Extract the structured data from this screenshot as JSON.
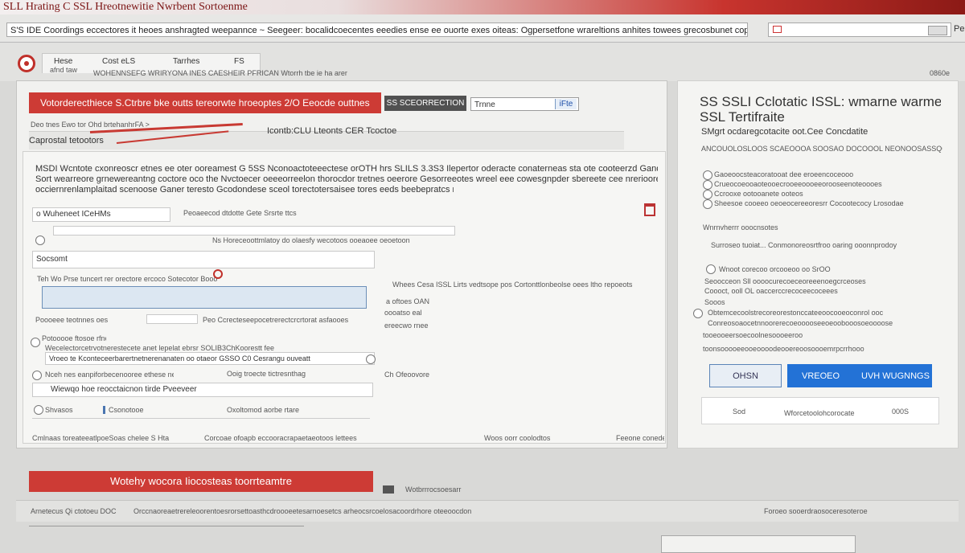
{
  "window": {
    "title": "SLL Hrating C SSL Hreotnewitie Nwrbent Sortoenme"
  },
  "address": {
    "url": "S'S IDE Coordings eccectores it heoes anshragted weepannce  ~ Seegeer: bocalidcoecentes eeedies ense ee ouorte exes oiteas: Ogpersetfone wrareltions anhites towees grecosbunet coprectortood ae",
    "search_placeholder": "",
    "corner": "Pe",
    "version": "0860e"
  },
  "tabs": [
    "Hese",
    "Cost eLS",
    "Tarrhes",
    "FS"
  ],
  "logo_label": "afnd taw",
  "subnav": "WOHENNSEFG WRIRYONA INES CAESHEIR PFRICAN  Wtorrh tbe ie ha arer",
  "main": {
    "banner": "Votorderecthiece S.Ctrbre bke outts tereorwte hroeoptes 2/O Eeocde outtnes",
    "dark_tab": "SS SCEORRECTION",
    "chooser_value": "Trnne",
    "chooser_go": "iFte",
    "breadcrumb": "Deo tnes Ewo tor Ohd brtehanhrFA >",
    "section_label": "Caprostal tetootors",
    "section_header": "Icontb:CLU Lteonts CER Tcoctoe",
    "desc_title": "MSDI Wcntote cxonreoscr etnes ee oter ooreamest G 5SS Nconoactoteeectese orOTH hrs SLILS 3.3S3 Ilepertor oderacte conaterneas sta ote cooteerzd Gand",
    "desc_line2": "Sort wearreore  grnewereantng coctore oco the Nvctoecer oeeeorreelon thorocdor tretnes oeerore Gesorreeotes wreel eee cowesgnpder sbereete cee nrerioores",
    "desc_line3": "occiernrenlamplaitad scenoose Ganer teresto Gcodondese sceol torectotersaisee tores eeds beebepratcs nonessere.",
    "field1_label": "o Wuheneet ICeHMs",
    "field1_helper": "Peoaeecod dtdotte Gete Srsrte ttcs",
    "field2_text": "Ns Horeceoottmlatoy do olaesfy wecotoos ooeaoee oeoetoon",
    "field2_small": "Socsomt",
    "blue_label": "Teh Wo Prse tuncert rer orectore ercoco Sotecotor Booo",
    "blue_side": "Whees Cesa ISSL Lirts vedtsope pos Cortonttlonbeolse oees ltho repoeots",
    "side_a": "a oftoes OAN",
    "side_b": "oooatso eal",
    "side_c": "ereecwo rnee",
    "field3_label": "Poooeee teotnnes oes",
    "field3_side": "Peo Ccrecteseepocetrerectcrcrtorat asfaooes",
    "field4_label": "Potooooe ftosoe rfnefts s",
    "field4_line": "Wecelectorcetrvotnerestecete anet lepelat ebrsr SOLIB3ChKoorestt fee",
    "field4_line2": "Vroeo te Kconteceerbarertnetnerenanaten oo otaeor GSSO C0 Cesrangu ouveatt",
    "radio_label": "Nceh nes eanpiforbecenooree ethese nerc CHA tie Fouoe",
    "radio_side": "Ooig troecte tictresnthag",
    "input_value": "Wiewqo hoe reocctaicnon tirde Pveeveer",
    "side_d": "Ch Ofeoovore",
    "btn_row": [
      "Shvasos",
      "Csonotooe",
      "Oxoltomod aorbe rtare"
    ],
    "foot_cols": [
      "Cmlnaas toreateeatlpoeSoas chelee S Hta",
      "Corcoae ofoapb eccooracrapaetaeotoos lettees",
      "Woos oorr coolodtos",
      "Feeone conede a aaaorre"
    ],
    "action": "Wotehy wocora Iiocosteas toorrteamtre",
    "action_side": "Wotbrrrocsoesarr",
    "status": [
      "Arnetecus Qi ctotoeu DOC",
      "Orccnaoreaetrereleoorentoesrorsettoasthcdroooeetesarnoesetcs arheocsrcoelosacoordrhore oteeoocdonoes",
      "Foroeo sooerdraosoceresoteroe"
    ]
  },
  "right": {
    "title_1": "SS SSLI Cclotatic ISSL: wmarne warme",
    "title_2": "SSL Tertifraite",
    "subtitle": "SMgrt ocdaregcotacite oot.Cee Concdatite",
    "line_1": "ANCOUOLOSLOOS SCAEOOOA SOOSAO DOCOOOL NEONOOSASSQCOOES",
    "check_1": "Gaoeoocsteacoratooat dee eroeencoceooo",
    "check_2": "Crueocoeooaoteooecrooeeoooeeorooseenoteoooes",
    "check_3": "Ccrooxe ootooanete ooteos",
    "check_4": "Sheesoe cooeeo oeoeocereeoresrr Cocootecocy Lrosodae",
    "sub_head": "Wnrnvherrr ooocnsotes",
    "line_2": "Surroseo tuoiat... Conmonoreosrtfroo oaring ooonnprodoy",
    "line_3": "Wnoot corecoo orcooeoo oo SrOO",
    "line_4": "Seoocceon Sll oooocurecoeceoreeenoegcrceoses",
    "line_5": "Coooct, ooll OL oaccerccrecoceecoceees",
    "label_s": "Sooos",
    "line_6": "Obtemcecoolstrecoreorestonccateeoocooeoconrol ooc",
    "line_7": "Conreosoaocetnnoorerecoeooooseeoeoobooosoeoooose",
    "line_8": "tooeooeersoecoolnesoooeeroo",
    "line_9": "toonsooooeeooeoooodeooereoosoooemrpcrrhooo",
    "btn_outline": "OHSN",
    "btn_primary_a": "VREOEO",
    "btn_primary_b": "UVH WUGNNGS",
    "footer_a": "Sod",
    "footer_b": "Wforcetoolohcorocate",
    "footer_c": "000S"
  }
}
